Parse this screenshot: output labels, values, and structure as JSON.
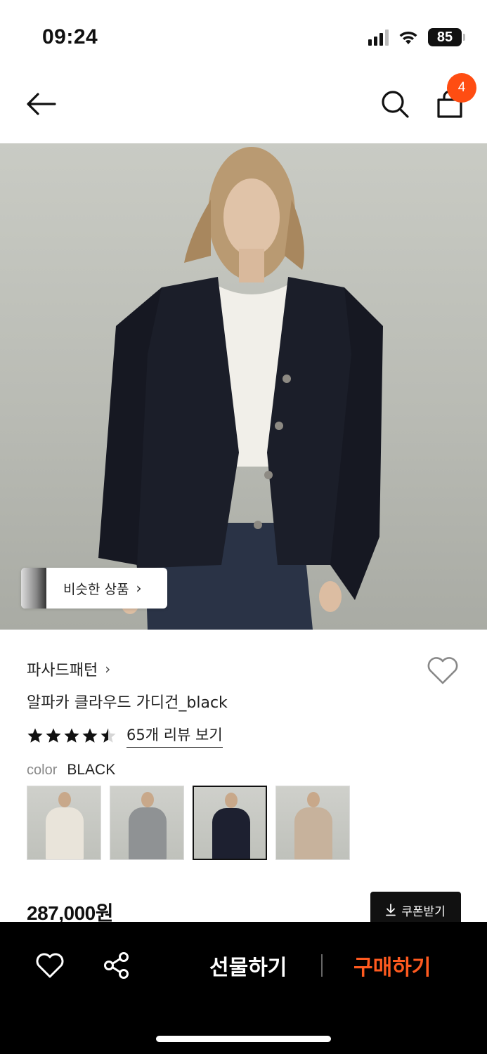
{
  "status": {
    "time": "09:24",
    "battery": "85",
    "icons": [
      "signal-icon",
      "wifi-icon",
      "battery-icon"
    ]
  },
  "nav": {
    "icons": [
      "back-arrow-icon",
      "search-icon",
      "shopping-bag-icon"
    ],
    "cart_count": "4",
    "badge_color": "#ff4d12"
  },
  "hero": {
    "similar_label": "비슷한 상품"
  },
  "product": {
    "brand": "파사드패턴",
    "name": "알파카 클라우드 가디건_black",
    "rating": 4.5,
    "rating_max": 5,
    "review_link": "65개 리뷰 보기",
    "color_label": "color",
    "color_value": "BLACK",
    "swatches": [
      {
        "color": "ivory",
        "hex": "#e9e4da",
        "selected": false
      },
      {
        "color": "gray",
        "hex": "#8f9294",
        "selected": false
      },
      {
        "color": "black",
        "hex": "#1d2030",
        "selected": true
      },
      {
        "color": "beige",
        "hex": "#c7b29c",
        "selected": false
      }
    ],
    "price": "287,000원",
    "coupon_label": "쿠폰받기"
  },
  "bottom_bar": {
    "gift_label": "선물하기",
    "buy_label": "구매하기",
    "buy_color": "#ff5a1f",
    "icons": [
      "heart-icon",
      "share-icon"
    ]
  }
}
